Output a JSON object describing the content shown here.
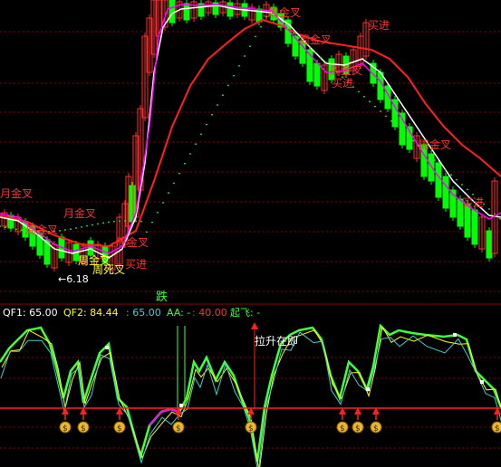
{
  "colors": {
    "background": "#000000",
    "grid": "#8b0000",
    "up_candle": "#ff3030",
    "down_candle": "#00ff00",
    "red_line": "#ff2020",
    "white_line": "#ffffff",
    "magenta_line": "#ff00ff",
    "yellow_line": "#ffff00",
    "cyan_line": "#40d0d0",
    "green_line": "#40ff40",
    "dotted_line": "#20ff20",
    "annotation_red": "#ff3030",
    "annotation_yellow": "#ffff40",
    "baseline_red": "#ff2020"
  },
  "price_panel": {
    "annotations": [
      {
        "text": "月金叉",
        "color": "red"
      },
      {
        "text": "月金叉",
        "color": "red"
      },
      {
        "text": "买进",
        "color": "red"
      },
      {
        "text": "周金叉",
        "color": "red"
      },
      {
        "text": "周金叉",
        "color": "yellow"
      },
      {
        "text": "周死叉",
        "color": "yellow"
      },
      {
        "text": "买进",
        "color": "red"
      },
      {
        "text": "周金叉",
        "color": "red"
      },
      {
        "text": "周金叉",
        "color": "red"
      },
      {
        "text": "周金叉",
        "color": "red"
      },
      {
        "text": "买进",
        "color": "red"
      },
      {
        "text": "周金叉",
        "color": "red"
      },
      {
        "text": "周金叉",
        "color": "red"
      },
      {
        "text": "买进",
        "color": "red"
      }
    ],
    "low_marker": "←6.18",
    "signal_label": "跌"
  },
  "indicator_panel": {
    "header": [
      {
        "text": "QF1: 65.00",
        "color": "#ffffff"
      },
      {
        "text": "QF2: 84.44",
        "color": "#ffff00"
      },
      {
        "text": ": 65.00",
        "color": "#40d0d0"
      },
      {
        "text": "AA: -",
        "color": "#40ff40"
      },
      {
        "text": ": 40.00",
        "color": "#ff3030"
      },
      {
        "text": "起飞: -",
        "color": "#40ff40"
      }
    ],
    "annotation": "拉升在即",
    "money_icon_glyph": "$",
    "money_icon_count": 9
  }
}
